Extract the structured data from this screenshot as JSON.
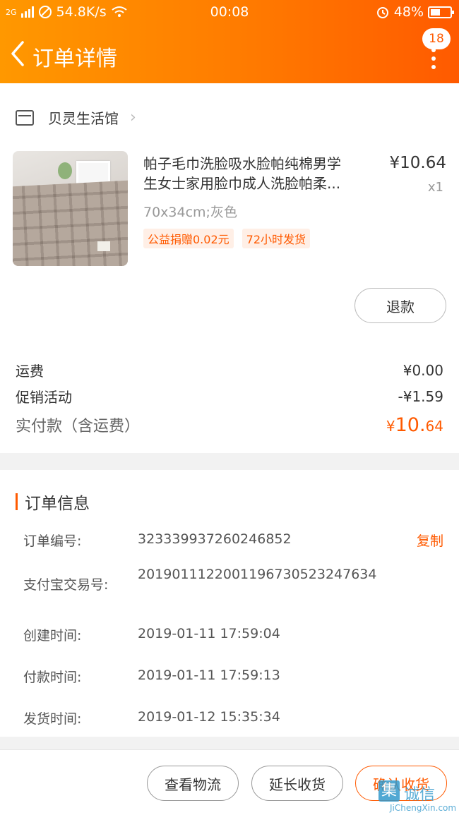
{
  "status_bar": {
    "signal_text": "2G",
    "speed": "54.8K/s",
    "time": "00:08",
    "battery": "48%",
    "battery_level_fraction": 0.48
  },
  "nav": {
    "title": "订单详情",
    "badge_count": "18",
    "icons": [
      "chevron-left-icon",
      "more-vertical-icon"
    ]
  },
  "shop": {
    "name": "贝灵生活馆",
    "icons": [
      "store-icon",
      "chevron-right-icon"
    ]
  },
  "product": {
    "title_line1": "帕子毛巾洗脸吸水脸帕纯棉男学",
    "title_line2": "生女士家用脸巾成人洗脸帕柔...",
    "price": "¥10.64",
    "quantity": "x1",
    "sku": "70x34cm;灰色",
    "tags": [
      "公益捐赠0.02元",
      "72小时发货"
    ],
    "refund_label": "退款"
  },
  "summary": {
    "shipping_label": "运费",
    "shipping_value": "¥0.00",
    "promo_label": "促销活动",
    "promo_value": "-¥1.59",
    "total_label": "实付款（含运费）",
    "total_currency": "¥",
    "total_major": "10.",
    "total_minor": "64"
  },
  "order_info": {
    "section_title": "订单信息",
    "copy_label": "复制",
    "rows": [
      {
        "label": "订单编号:",
        "value": "323339937260246852"
      },
      {
        "label": "支付宝交易号:",
        "value": "2019011122001196730523247634"
      },
      {
        "label": "创建时间:",
        "value": "2019-01-11 17:59:04"
      },
      {
        "label": "付款时间:",
        "value": "2019-01-11 17:59:13"
      },
      {
        "label": "发货时间:",
        "value": "2019-01-12 15:35:34"
      }
    ]
  },
  "actions": {
    "logistics": "查看物流",
    "extend": "延长收货",
    "confirm": "确认收货"
  },
  "watermark": {
    "glyph": "集",
    "name": "诚信",
    "domain": "JiChengXin.com"
  },
  "colors": {
    "accent": "#ff5a00",
    "header_start": "#ff9800"
  }
}
